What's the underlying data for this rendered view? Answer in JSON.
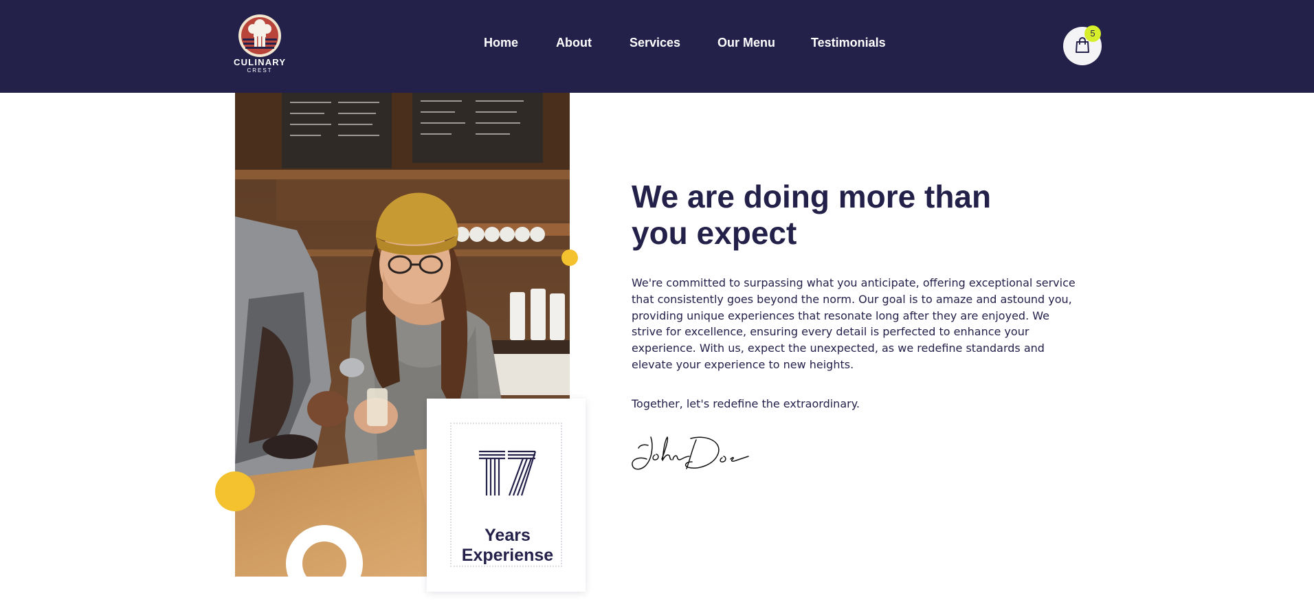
{
  "brand": {
    "name": "CULINARY",
    "tagline": "CREST"
  },
  "nav": {
    "items": [
      {
        "label": "Home"
      },
      {
        "label": "About"
      },
      {
        "label": "Services"
      },
      {
        "label": "Our Menu"
      },
      {
        "label": "Testimonials"
      }
    ]
  },
  "cart": {
    "count": "5",
    "icon": "shopping-bag-icon"
  },
  "about": {
    "heading_line1": "We are doing more than",
    "heading_line2": "you expect",
    "paragraph": "We're committed to surpassing what you anticipate, offering exceptional service that consistently goes beyond the norm. Our goal is to amaze and astound you, providing unique experiences that resonate long after they are enjoyed. We strive for excellence, ensuring every detail is perfected to enhance your experience. With us, expect the unexpected, as we redefine standards and elevate your experience to new heights.",
    "closing": "Together, let's redefine the extraordinary.",
    "signature": "John Doe"
  },
  "experience": {
    "number": "17",
    "label_line1": "Years",
    "label_line2": "Experiense"
  },
  "colors": {
    "header_bg": "#23204a",
    "accent_yellow": "#f4c22f",
    "badge_green": "#d6ef2a",
    "text_dark": "#23204a"
  }
}
